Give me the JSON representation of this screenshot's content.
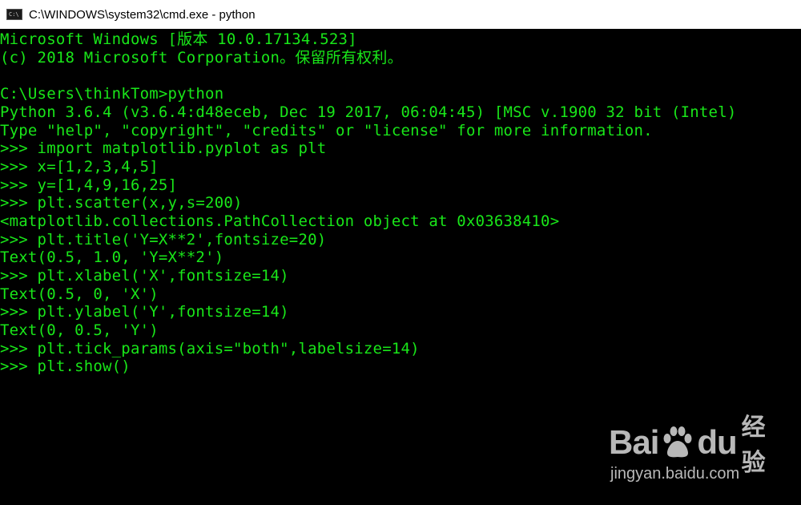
{
  "window": {
    "title": "C:\\WINDOWS\\system32\\cmd.exe - python",
    "icon": "cmd-icon",
    "icon_glyph": "C:\\"
  },
  "console": {
    "text_color": "#19e619",
    "background_color": "#000000",
    "lines": [
      "Microsoft Windows [版本 10.0.17134.523]",
      "(c) 2018 Microsoft Corporation。保留所有权利。",
      "",
      "C:\\Users\\thinkTom>python",
      "Python 3.6.4 (v3.6.4:d48eceb, Dec 19 2017, 06:04:45) [MSC v.1900 32 bit (Intel)",
      "Type \"help\", \"copyright\", \"credits\" or \"license\" for more information.",
      ">>> import matplotlib.pyplot as plt",
      ">>> x=[1,2,3,4,5]",
      ">>> y=[1,4,9,16,25]",
      ">>> plt.scatter(x,y,s=200)",
      "<matplotlib.collections.PathCollection object at 0x03638410>",
      ">>> plt.title('Y=X**2',fontsize=20)",
      "Text(0.5, 1.0, 'Y=X**2')",
      ">>> plt.xlabel('X',fontsize=14)",
      "Text(0.5, 0, 'X')",
      ">>> plt.ylabel('Y',fontsize=14)",
      "Text(0, 0.5, 'Y')",
      ">>> plt.tick_params(axis=\"both\",labelsize=14)",
      ">>> plt.show()"
    ]
  },
  "watermark": {
    "brand_left": "Bai",
    "brand_right": "du",
    "brand_cn": "经验",
    "url": "jingyan.baidu.com",
    "icon": "baidu-paw-icon"
  }
}
